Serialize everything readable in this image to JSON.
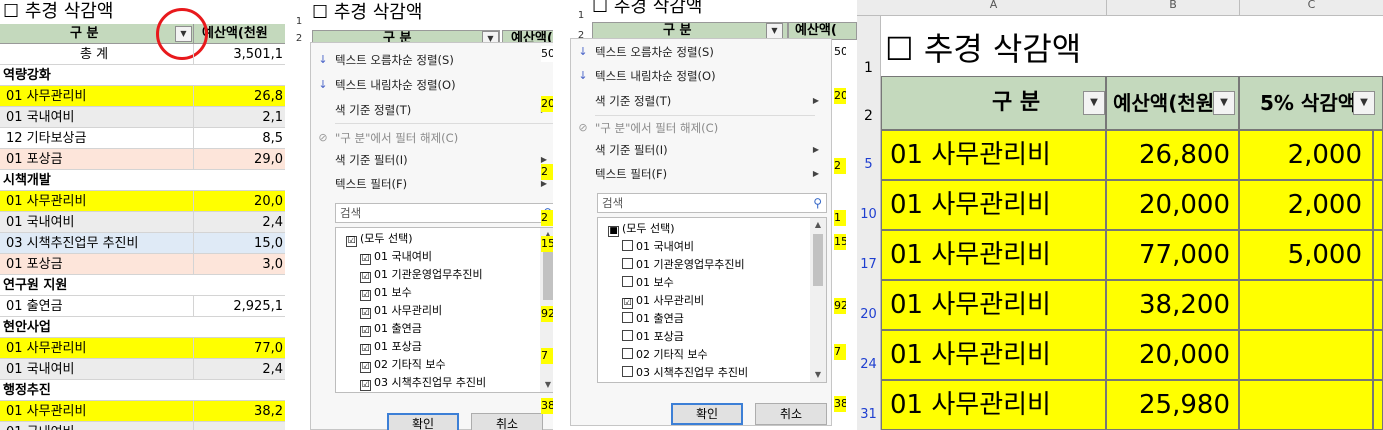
{
  "panel1": {
    "title": "☐ 추경 삭감액",
    "header_col1": "구 분",
    "header_col2": "예산액(천원",
    "total_label": "총 계",
    "total_value": "3,501,1",
    "rows": [
      {
        "label": "역량강화",
        "value": "",
        "style": "bold"
      },
      {
        "label": "01 사무관리비",
        "value": "26,8",
        "style": "yellow"
      },
      {
        "label": "01 국내여비",
        "value": "2,1",
        "style": "gray"
      },
      {
        "label": "12 기타보상금",
        "value": "8,5",
        "style": "plain"
      },
      {
        "label": "01 포상금",
        "value": "29,0",
        "style": "pink"
      },
      {
        "label": "시책개발",
        "value": "",
        "style": "bold"
      },
      {
        "label": "01 사무관리비",
        "value": "20,0",
        "style": "yellow"
      },
      {
        "label": "01 국내여비",
        "value": "2,4",
        "style": "gray"
      },
      {
        "label": "03 시책추진업무 추진비",
        "value": "15,0",
        "style": "blue"
      },
      {
        "label": "01 포상금",
        "value": "3,0",
        "style": "pink"
      },
      {
        "label": "연구원 지원",
        "value": "",
        "style": "bold"
      },
      {
        "label": "01 출연금",
        "value": "2,925,1",
        "style": "plain"
      },
      {
        "label": "현안사업",
        "value": "",
        "style": "bold"
      },
      {
        "label": "01 사무관리비",
        "value": "77,0",
        "style": "yellow"
      },
      {
        "label": "01 국내여비",
        "value": "2,4",
        "style": "gray"
      },
      {
        "label": "행정추진",
        "value": "",
        "style": "bold"
      },
      {
        "label": "01 사무관리비",
        "value": "38,2",
        "style": "yellow"
      },
      {
        "label": "01 국내여비",
        "value": "",
        "style": "gray"
      }
    ]
  },
  "filter1": {
    "title": "☐ 추경 삭감액",
    "header_col1": "구 분",
    "header_col2": "예산액(",
    "row_numbers": [
      "1",
      "2"
    ],
    "right_values": [
      "50",
      "20",
      "2",
      "2",
      "15",
      "92",
      "7",
      "38"
    ],
    "menu": {
      "sort_asc": "텍스트 오름차순 정렬(S)",
      "sort_desc": "텍스트 내림차순 정렬(O)",
      "sort_color": "색 기준 정렬(T)",
      "clear_filter": "\"구 분\"에서 필터 해제(C)",
      "filter_color": "색 기준 필터(I)",
      "text_filter": "텍스트 필터(F)"
    },
    "search_placeholder": "검색",
    "items": [
      {
        "label": "(모두 선택)",
        "state": "☑"
      },
      {
        "label": "01 국내여비",
        "state": "☑"
      },
      {
        "label": "01 기관운영업무추진비",
        "state": "☑"
      },
      {
        "label": "01 보수",
        "state": "☑"
      },
      {
        "label": "01 사무관리비",
        "state": "☑"
      },
      {
        "label": "01 출연금",
        "state": "☑"
      },
      {
        "label": "01 포상금",
        "state": "☑"
      },
      {
        "label": "02 기타직 보수",
        "state": "☑"
      },
      {
        "label": "03 시책추진업무 추진비",
        "state": "☑"
      }
    ],
    "ok": "확인",
    "cancel": "취소"
  },
  "filter2": {
    "title": "☐ 추경 삭감액",
    "header_col1": "구 분",
    "header_col2": "예산액(",
    "row_numbers": [
      "1",
      "2"
    ],
    "right_values": [
      "50",
      "20",
      "2",
      "1",
      "15",
      "92",
      "7",
      "38"
    ],
    "menu": {
      "sort_asc": "텍스트 오름차순 정렬(S)",
      "sort_desc": "텍스트 내림차순 정렬(O)",
      "sort_color": "색 기준 정렬(T)",
      "clear_filter": "\"구 분\"에서 필터 해제(C)",
      "filter_color": "색 기준 필터(I)",
      "text_filter": "텍스트 필터(F)"
    },
    "search_placeholder": "검색",
    "items": [
      {
        "label": "(모두 선택)",
        "state": "■"
      },
      {
        "label": "01 국내여비",
        "state": ""
      },
      {
        "label": "01 기관운영업무추진비",
        "state": ""
      },
      {
        "label": "01 보수",
        "state": ""
      },
      {
        "label": "01 사무관리비",
        "state": "☑"
      },
      {
        "label": "01 출연금",
        "state": ""
      },
      {
        "label": "01 포상금",
        "state": ""
      },
      {
        "label": "02 기타직 보수",
        "state": ""
      },
      {
        "label": "03 시책추진업무 추진비",
        "state": ""
      }
    ],
    "ok": "확인",
    "cancel": "취소"
  },
  "panel4": {
    "col_letters": [
      "A",
      "B",
      "C"
    ],
    "title": "☐ 추경 삭감액",
    "title_row": "1",
    "header_row": "2",
    "header_col1": "구 분",
    "header_col2": "예산액(천원",
    "header_col3": "5% 삭감액",
    "rows": [
      {
        "rownum": "5",
        "label": "01 사무관리비",
        "budget": "26,800",
        "cut": "2,000"
      },
      {
        "rownum": "10",
        "label": "01 사무관리비",
        "budget": "20,000",
        "cut": "2,000"
      },
      {
        "rownum": "17",
        "label": "01 사무관리비",
        "budget": "77,000",
        "cut": "5,000"
      },
      {
        "rownum": "20",
        "label": "01 사무관리비",
        "budget": "38,200",
        "cut": ""
      },
      {
        "rownum": "24",
        "label": "01 사무관리비",
        "budget": "20,000",
        "cut": ""
      },
      {
        "rownum": "31",
        "label": "01 사무관리비",
        "budget": "25,980",
        "cut": ""
      }
    ],
    "colors": {
      "highlight": "#ffff00",
      "header": "#c4d9bd",
      "rownum_filtered": "#1f3fd0"
    }
  }
}
